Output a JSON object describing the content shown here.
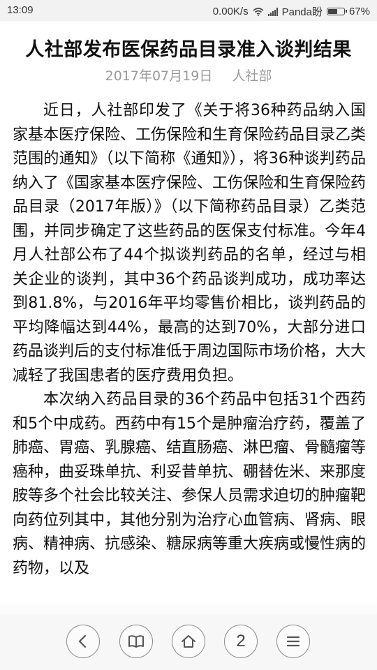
{
  "status_bar": {
    "time": "13:09",
    "network_speed": "0.00K/s",
    "carrier": "Panda盼",
    "battery": "67%",
    "battery_level": 0.67
  },
  "article": {
    "title": "人社部发布医保药品目录准入谈判结果",
    "date": "2017年07月19日",
    "source": "人社部",
    "paragraphs": [
      "近日，人社部印发了《关于将36种药品纳入国家基本医疗保险、工伤保险和生育保险药品目录乙类范围的通知》（以下简称《通知》），将36种谈判药品纳入了《国家基本医疗保险、工伤保险和生育保险药品目录（2017年版）》（以下简称药品目录）乙类范围，并同步确定了这些药品的医保支付标准。今年4月人社部公布了44个拟谈判药品的名单，经过与相关企业的谈判，其中36个药品谈判成功，成功率达到81.8%，与2016年平均零售价相比，谈判药品的平均降幅达到44%，最高的达到70%，大部分进口药品谈判后的支付标准低于周边国际市场价格，大大减轻了我国患者的医疗费用负担。",
      "本次纳入药品目录的36个药品中包括31个西药和5个中成药。西药中有15个是肿瘤治疗药，覆盖了肺癌、胃癌、乳腺癌、结直肠癌、淋巴瘤、骨髓瘤等癌种，曲妥珠单抗、利妥昔单抗、硼替佐米、来那度胺等多个社会比较关注、参保人员需求迫切的肿瘤靶向药位列其中，其他分别为治疗心血管病、肾病、眼病、精神病、抗感染、糖尿病等重大疾病或慢性病的药物，以及"
    ]
  },
  "toolbar": {
    "tab_count": "2",
    "icons": [
      "back-icon",
      "bookmarks-icon",
      "home-icon",
      "tabs-counter",
      "menu-icon"
    ]
  }
}
